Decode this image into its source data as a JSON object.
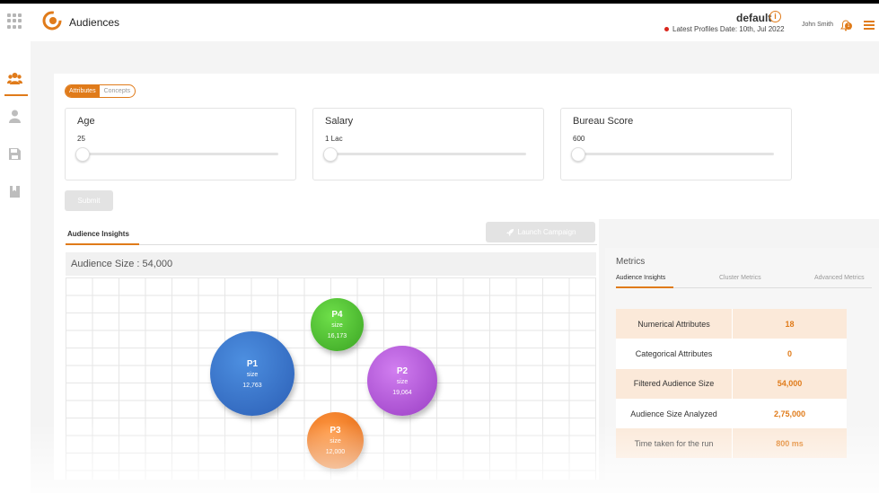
{
  "header": {
    "app_title": "Audiences",
    "environment": "default",
    "latest_profiles": "Latest Profiles Date: 10th, Jul 2022",
    "user_name": "John Smith",
    "notification_count": "1"
  },
  "filters": {
    "tabs": [
      "Attributes",
      "Concepts"
    ],
    "active_tab": "Attributes",
    "sliders": [
      {
        "label": "Age",
        "value": "25"
      },
      {
        "label": "Salary",
        "value": "1 Lac"
      },
      {
        "label": "Bureau Score",
        "value": "600"
      }
    ],
    "submit_label": "Submit"
  },
  "insights": {
    "tab_label": "Audience Insights",
    "launch_label": "Launch Campaign",
    "audience_size": "Audience Size : 54,000",
    "bubbles": [
      {
        "name": "P1",
        "size_label": "size",
        "count": "12,763",
        "color": "#3a74c9"
      },
      {
        "name": "P2",
        "size_label": "size",
        "count": "19,064",
        "color": "#b65ad8"
      },
      {
        "name": "P3",
        "size_label": "size",
        "count": "12,000",
        "color": "#f0761a"
      },
      {
        "name": "P4",
        "size_label": "size",
        "count": "16,173",
        "color": "#4dbf2f"
      }
    ]
  },
  "metrics": {
    "title": "Metrics",
    "tabs": [
      "Audience Insights",
      "Cluster Metrics",
      "Advanced Metrics"
    ],
    "active_tab": "Audience Insights",
    "rows": [
      {
        "label": "Numerical Attributes",
        "value": "18"
      },
      {
        "label": "Categorical Attributes",
        "value": "0"
      },
      {
        "label": "Filtered Audience Size",
        "value": "54,000"
      },
      {
        "label": "Audience Size Analyzed",
        "value": "2,75,000"
      },
      {
        "label": "Time taken for the run",
        "value": "800 ms"
      }
    ]
  },
  "colors": {
    "accent": "#e07b1a"
  }
}
